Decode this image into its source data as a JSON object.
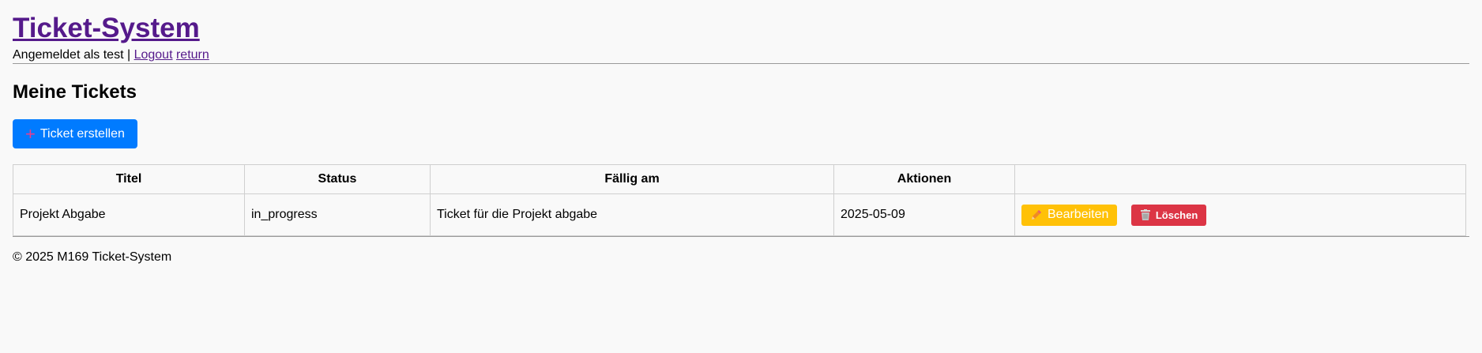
{
  "header": {
    "site_title": "Ticket-System",
    "logged_in_text": "Angemeldet als test |",
    "logout_link": "Logout",
    "return_link": "return"
  },
  "main": {
    "section_title": "Meine Tickets",
    "create_button_label": "Ticket erstellen",
    "table": {
      "columns": [
        "Titel",
        "Status",
        "Fällig am",
        "Aktionen",
        ""
      ],
      "rows": [
        {
          "title": "Projekt Abgabe",
          "status": "in_progress",
          "description": "Ticket für die Projekt abgabe",
          "due": "2025-05-09",
          "edit_label": "Bearbeiten",
          "delete_label": "Löschen"
        }
      ]
    }
  },
  "footer": {
    "text": "© 2025 M169 Ticket-System"
  },
  "icons": {
    "create": "plus-icon",
    "edit": "pencil-icon",
    "delete": "trash-icon"
  },
  "colors": {
    "link": "#551a8b",
    "primary": "#007bff",
    "warning": "#ffc107",
    "danger": "#dc3545",
    "background": "#f9f9f9"
  }
}
